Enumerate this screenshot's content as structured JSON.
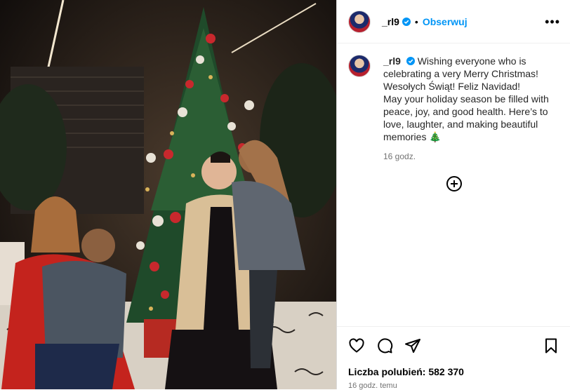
{
  "post": {
    "username": "_rl9",
    "dot": "•",
    "follow_label": "Obserwuj",
    "more_label": "•••",
    "caption": "Wishing everyone who is celebrating a very Merry Christmas! Wesołych Świąt! Feliz Navidad!\nMay your holiday season be filled with peace, joy, and good health. Here’s to love, laughter, and making beautiful memories 🎄",
    "caption_time": "16 godz.",
    "likes": "Liczba polubień: 582 370",
    "posted_time": "16 godz. temu"
  },
  "icons": {
    "verified": "verified-badge-icon",
    "add": "add-circle-icon",
    "like": "heart-icon",
    "comment": "comment-icon",
    "share": "share-icon",
    "save": "bookmark-icon"
  },
  "colors": {
    "follow": "#0095f6",
    "verified": "#0095f6",
    "muted": "#737373"
  }
}
